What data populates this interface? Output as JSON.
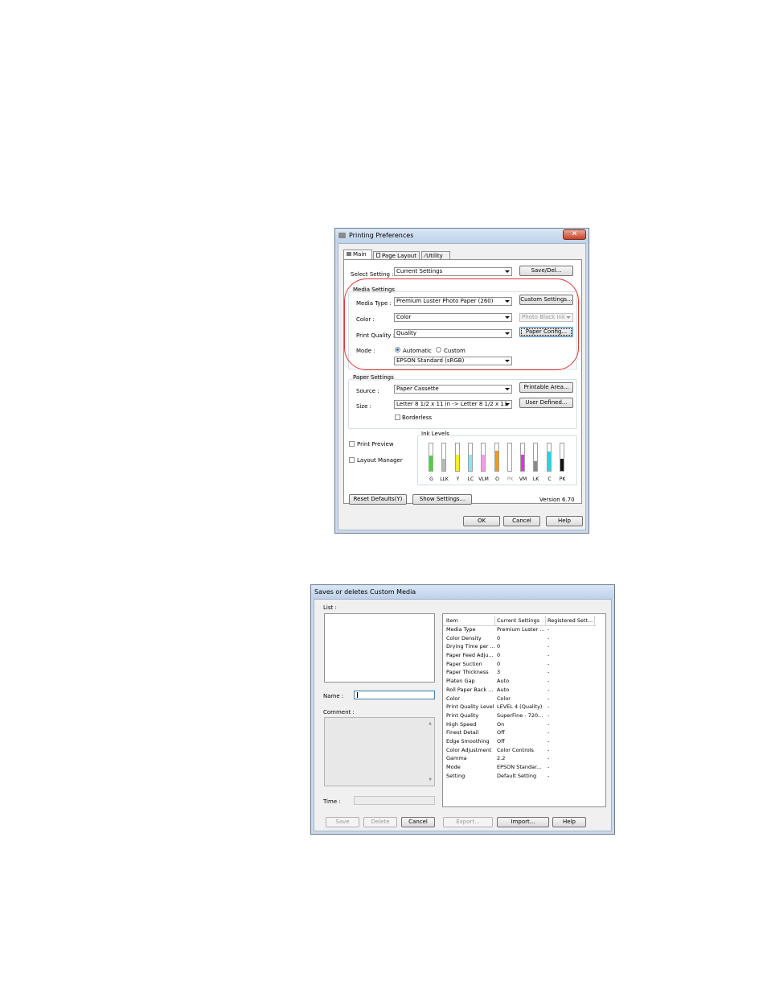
{
  "dialog1": {
    "title": "Printing Preferences",
    "tabs": [
      {
        "label": "Main"
      },
      {
        "label": "Page Layout"
      },
      {
        "label": "Utility"
      }
    ],
    "select_setting": {
      "label": "Select Setting :",
      "value": "Current Settings"
    },
    "save_del_label": "Save/Del...",
    "media_settings": {
      "title": "Media Settings",
      "media_type": {
        "label": "Media Type :",
        "value": "Premium Luster Photo Paper (260)"
      },
      "custom_settings_label": "Custom Settings...",
      "color": {
        "label": "Color :",
        "value": "Color"
      },
      "black_ink": "Photo Black Ink",
      "print_quality": {
        "label": "Print Quality :",
        "value": "Quality"
      },
      "paper_config_label": "Paper Config...",
      "mode": {
        "label": "Mode :",
        "automatic": "Automatic",
        "custom": "Custom",
        "value": "EPSON Standard (sRGB)"
      }
    },
    "paper_settings": {
      "title": "Paper Settings",
      "source": {
        "label": "Source :",
        "value": "Paper Cassette"
      },
      "printable_area_label": "Printable Area...",
      "size": {
        "label": "Size :",
        "value": "Letter 8 1/2 x 11 in -> Letter 8 1/2 x 11 in"
      },
      "user_defined_label": "User Defined...",
      "borderless": "Borderless"
    },
    "print_preview": "Print Preview",
    "layout_manager": "Layout Manager",
    "ink_levels": {
      "title": "Ink Levels",
      "inks": [
        {
          "label": "G",
          "color": "#4fd33a",
          "level": 0.55
        },
        {
          "label": "LLK",
          "color": "#b9b9b9",
          "level": 0.45
        },
        {
          "label": "Y",
          "color": "#f4ef1f",
          "level": 0.6
        },
        {
          "label": "LC",
          "color": "#8ee3f2",
          "level": 0.6
        },
        {
          "label": "VLM",
          "color": "#f29cf0",
          "level": 0.6
        },
        {
          "label": "O",
          "color": "#f39a1a",
          "level": 0.75
        },
        {
          "label": "PK",
          "color": "#d8d8d8",
          "level": 0.0
        },
        {
          "label": "VM",
          "color": "#e62fe0",
          "level": 0.6
        },
        {
          "label": "LK",
          "color": "#8a8a8a",
          "level": 0.35
        },
        {
          "label": "C",
          "color": "#21d6e6",
          "level": 0.7
        },
        {
          "label": "PK",
          "color": "#111111",
          "level": 0.45
        }
      ]
    },
    "reset_defaults_label": "Reset Defaults(Y)",
    "show_settings_label": "Show Settings...",
    "version": "Version 6.70",
    "ok_label": "OK",
    "cancel_label": "Cancel",
    "help_label": "Help"
  },
  "dialog2": {
    "title": "Saves or deletes Custom Media",
    "list_label": "List :",
    "name_label": "Name :",
    "name_value": "",
    "comment_label": "Comment :",
    "time_label": "Time :",
    "table": {
      "headers": [
        "Item",
        "Current Settings",
        "Registered Sett..."
      ],
      "rows": [
        [
          "Media Type",
          "Premium Luster ...",
          "-"
        ],
        [
          "Color Density",
          "0",
          "-"
        ],
        [
          "Drying Time per ...",
          "0",
          "-"
        ],
        [
          "Paper Feed Adju...",
          "0",
          "-"
        ],
        [
          "Paper Suction",
          "0",
          "-"
        ],
        [
          "Paper Thickness",
          "3",
          "-"
        ],
        [
          "Platen Gap",
          "Auto",
          "-"
        ],
        [
          "Roll Paper Back ...",
          "Auto",
          "-"
        ],
        [
          "Color",
          "Color",
          "-"
        ],
        [
          "Print Quality Level",
          "LEVEL 4 (Quality)",
          "-"
        ],
        [
          "Print Quality",
          "SuperFine - 720...",
          "-"
        ],
        [
          "High Speed",
          "On",
          "-"
        ],
        [
          "Finest Detail",
          "Off",
          "-"
        ],
        [
          "Edge Smoothing",
          "Off",
          "-"
        ],
        [
          "Color Adjustment",
          "Color Controls",
          "-"
        ],
        [
          "Gamma",
          "2.2",
          "-"
        ],
        [
          "Mode",
          "EPSON Standar...",
          "-"
        ],
        [
          "Setting",
          "Default Setting",
          "-"
        ]
      ]
    },
    "buttons": {
      "save": "Save",
      "delete": "Delete",
      "cancel": "Cancel",
      "export": "Export...",
      "import": "Import...",
      "help": "Help"
    }
  }
}
